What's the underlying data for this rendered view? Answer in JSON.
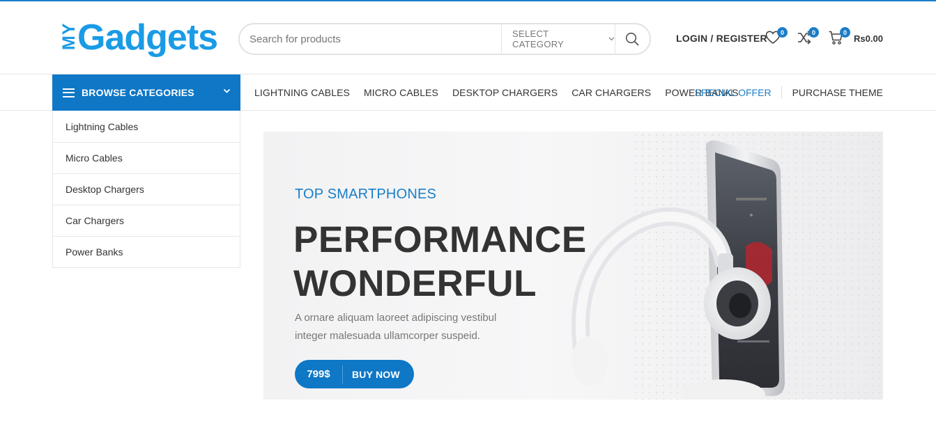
{
  "header": {
    "logo": {
      "prefix": "MY",
      "name": "Gadgets"
    },
    "search": {
      "placeholder": "Search for products",
      "category_label": "SELECT CATEGORY"
    },
    "login_label": "LOGIN / REGISTER",
    "wishlist_count": "0",
    "compare_count": "0",
    "cart_count": "0",
    "cart_total": "Rs0.00"
  },
  "nav": {
    "browse_label": "BROWSE CATEGORIES",
    "links": [
      "LIGHTNING CABLES",
      "MICRO CABLES",
      "DESKTOP CHARGERS",
      "CAR CHARGERS",
      "POWER BANKS"
    ],
    "special_offer": "SPECIAL OFFER",
    "purchase_theme": "PURCHASE THEME"
  },
  "categories": [
    "Lightning Cables",
    "Micro Cables",
    "Desktop Chargers",
    "Car Chargers",
    "Power Banks"
  ],
  "banner": {
    "subtitle": "TOP SMARTPHONES",
    "title_line1": "PERFORMANCE",
    "title_line2": "WONDERFUL",
    "description": "A ornare aliquam laoreet adipiscing vestibul integer malesuada ullamcorper suspeid.",
    "price": "799$",
    "button_label": "BUY NOW"
  },
  "colors": {
    "accent": "#0e77c6",
    "text": "#333333",
    "muted": "#777777"
  },
  "icons": [
    "search-icon",
    "heart-icon",
    "compare-icon",
    "cart-icon",
    "menu-icon",
    "chevron-down-icon"
  ]
}
